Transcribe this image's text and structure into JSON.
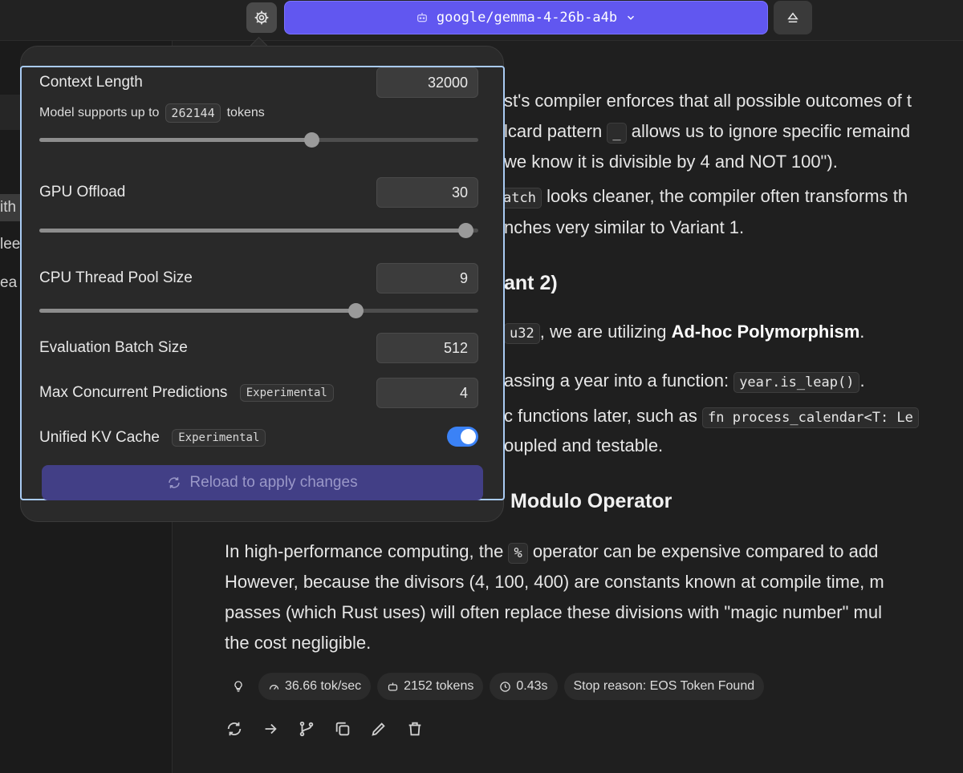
{
  "topbar": {
    "model_name": "google/gemma-4-26b-a4b",
    "icons": {
      "settings": "gear-icon",
      "model": "robot-icon",
      "chevron": "chevron-down-icon",
      "eject": "eject-icon"
    }
  },
  "sidebar": {
    "fragments": [
      "ith",
      "lee",
      "ea"
    ]
  },
  "chat": {
    "p1_a": "st's compiler enforces that all possible outcomes of t",
    "p1_b_pre": "lcard pattern",
    "p1_b_code": "_",
    "p1_b_post": "allows us to ignore specific remaind",
    "p1_c": "we know it is divisible by 4 and NOT 100\").",
    "p2_code": "atch",
    "p2_a": "looks cleaner, the compiler often transforms th",
    "p2_b": "nches very similar to Variant 1.",
    "heading1": "ant 2)",
    "p3_code": "u32",
    "p3_pre": ", we are utilizing",
    "p3_bold": "Ad-hoc Polymorphism",
    "p3_post": ".",
    "p4_pre": "assing a year into a function:",
    "p4_code": "year.is_leap()",
    "p4_post": ".",
    "p5_pre": "c functions later, such as",
    "p5_code": "fn process_calendar<T: Le",
    "p5_b": "oupled and testable.",
    "heading2": "Modulo Operator",
    "p6_a_pre": "In high-performance computing, the",
    "p6_a_code": "%",
    "p6_a_post": "operator can be expensive compared to add",
    "p6_b": "However, because the divisors (4, 100, 400) are constants known at compile time, m",
    "p6_c": "passes (which Rust uses) will often replace these divisions with \"magic number\" mul",
    "p6_d": "the cost negligible."
  },
  "stats": {
    "speed": "36.66 tok/sec",
    "tokens": "2152 tokens",
    "time": "0.43s",
    "stop_reason": "Stop reason: EOS Token Found"
  },
  "actions": [
    "regenerate-icon",
    "continue-arrow-icon",
    "branch-icon",
    "copy-icon",
    "edit-pencil-icon",
    "delete-trash-icon"
  ],
  "settings": {
    "context_length": {
      "label": "Context Length",
      "value": "32000",
      "supports_prefix": "Model supports up to",
      "supports_max": "262144",
      "supports_suffix": "tokens",
      "slider_fraction": 0.62
    },
    "gpu_offload": {
      "label": "GPU Offload",
      "value": "30",
      "slider_fraction": 0.97
    },
    "cpu_threads": {
      "label": "CPU Thread Pool Size",
      "value": "9",
      "slider_fraction": 0.72
    },
    "eval_batch": {
      "label": "Evaluation Batch Size",
      "value": "512"
    },
    "max_concurrent": {
      "label": "Max Concurrent Predictions",
      "badge": "Experimental",
      "value": "4"
    },
    "unified_kv": {
      "label": "Unified KV Cache",
      "badge": "Experimental",
      "enabled": true
    },
    "reload_label": "Reload to apply changes"
  },
  "colors": {
    "accent": "#6157f0",
    "toggle_on": "#3b82f6",
    "focus_ring": "#a9cbf3",
    "reload_bg": "#423f86"
  }
}
